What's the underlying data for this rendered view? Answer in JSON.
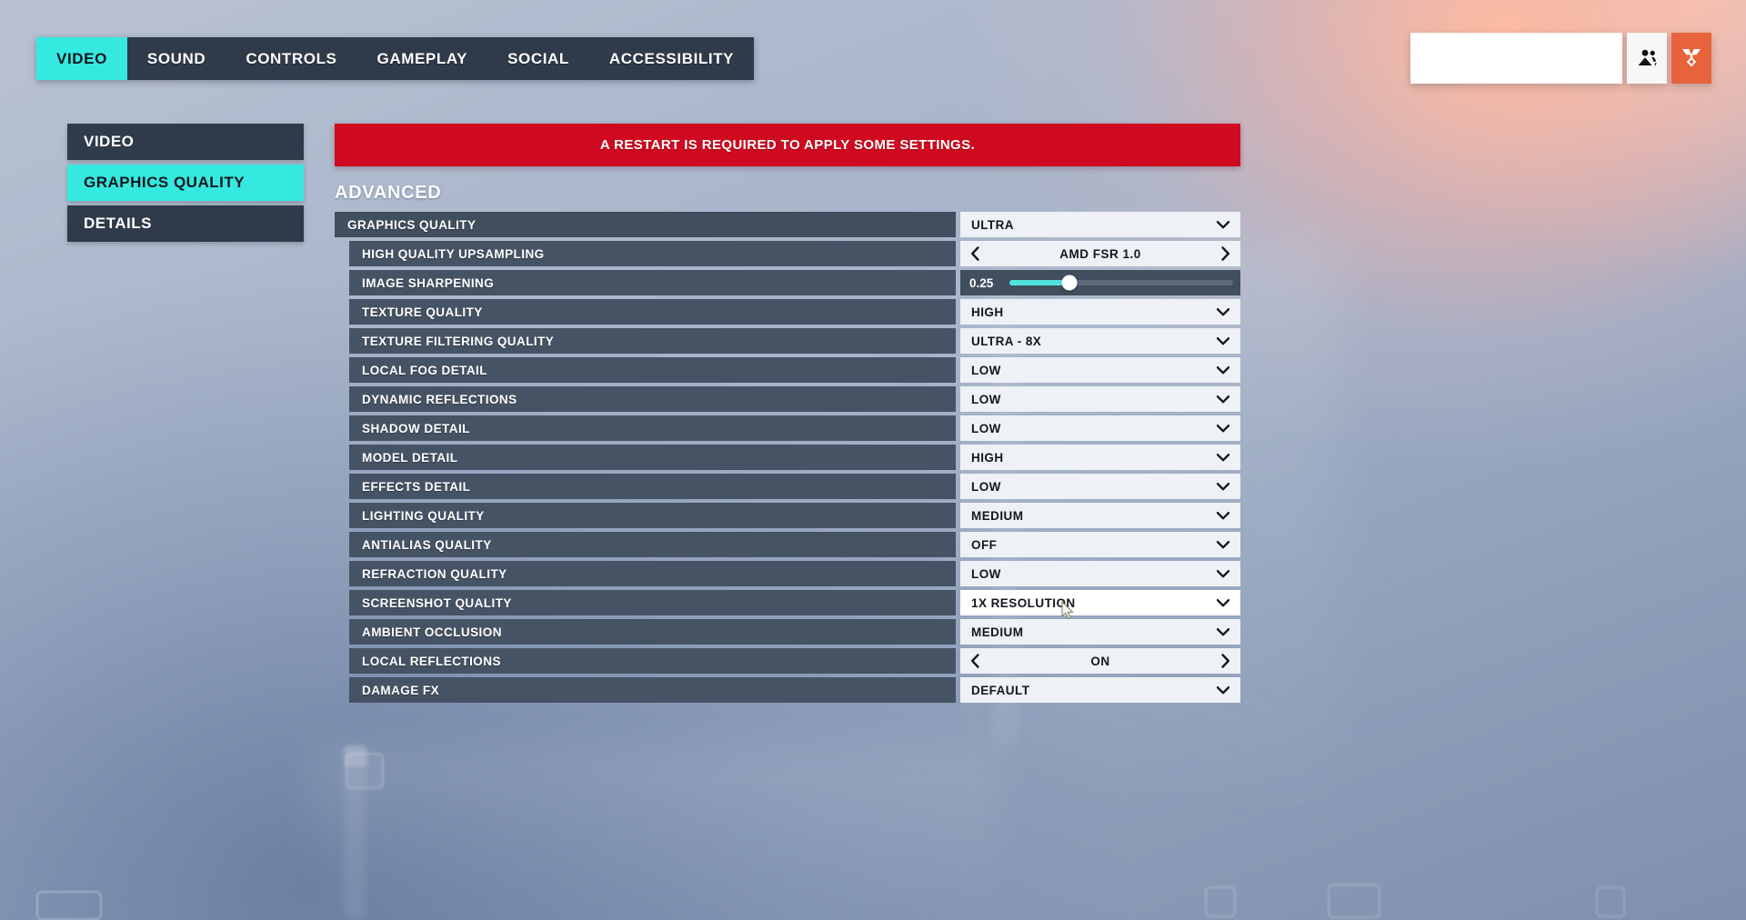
{
  "tabs": [
    {
      "label": "VIDEO",
      "active": true
    },
    {
      "label": "SOUND",
      "active": false
    },
    {
      "label": "CONTROLS",
      "active": false
    },
    {
      "label": "GAMEPLAY",
      "active": false
    },
    {
      "label": "SOCIAL",
      "active": false
    },
    {
      "label": "ACCESSIBILITY",
      "active": false
    }
  ],
  "hud": {
    "squad_icon": "squad-people-icon",
    "medal_icon": "medal-icon",
    "accent_color": "#e8633c"
  },
  "sidebar": {
    "items": [
      {
        "label": "VIDEO",
        "active": false
      },
      {
        "label": "GRAPHICS QUALITY",
        "active": true
      },
      {
        "label": "DETAILS",
        "active": false
      }
    ]
  },
  "banner": {
    "text": "A RESTART IS REQUIRED TO APPLY SOME SETTINGS.",
    "color": "#cf0a20"
  },
  "main": {
    "section_title": "ADVANCED",
    "accent_color": "#35e9e1",
    "settings": [
      {
        "label": "GRAPHICS QUALITY",
        "control": "dropdown",
        "value": "ULTRA",
        "indent": false,
        "hover": false
      },
      {
        "label": "HIGH QUALITY UPSAMPLING",
        "control": "stepper",
        "value": "AMD FSR 1.0",
        "indent": true,
        "hover": false
      },
      {
        "label": "IMAGE SHARPENING",
        "control": "slider",
        "value": "0.25",
        "indent": true,
        "hover": false,
        "percent": 27
      },
      {
        "label": "TEXTURE QUALITY",
        "control": "dropdown",
        "value": "HIGH",
        "indent": true,
        "hover": false
      },
      {
        "label": "TEXTURE FILTERING QUALITY",
        "control": "dropdown",
        "value": "ULTRA - 8X",
        "indent": true,
        "hover": false
      },
      {
        "label": "LOCAL FOG DETAIL",
        "control": "dropdown",
        "value": "LOW",
        "indent": true,
        "hover": false
      },
      {
        "label": "DYNAMIC REFLECTIONS",
        "control": "dropdown",
        "value": "LOW",
        "indent": true,
        "hover": false
      },
      {
        "label": "SHADOW DETAIL",
        "control": "dropdown",
        "value": "LOW",
        "indent": true,
        "hover": false
      },
      {
        "label": "MODEL DETAIL",
        "control": "dropdown",
        "value": "HIGH",
        "indent": true,
        "hover": false
      },
      {
        "label": "EFFECTS DETAIL",
        "control": "dropdown",
        "value": "LOW",
        "indent": true,
        "hover": false
      },
      {
        "label": "LIGHTING QUALITY",
        "control": "dropdown",
        "value": "MEDIUM",
        "indent": true,
        "hover": false
      },
      {
        "label": "ANTIALIAS QUALITY",
        "control": "dropdown",
        "value": "OFF",
        "indent": true,
        "hover": false
      },
      {
        "label": "REFRACTION QUALITY",
        "control": "dropdown",
        "value": "LOW",
        "indent": true,
        "hover": false
      },
      {
        "label": "SCREENSHOT QUALITY",
        "control": "dropdown",
        "value": "1X RESOLUTION",
        "indent": true,
        "hover": true
      },
      {
        "label": "AMBIENT OCCLUSION",
        "control": "dropdown",
        "value": "MEDIUM",
        "indent": true,
        "hover": false
      },
      {
        "label": "LOCAL REFLECTIONS",
        "control": "stepper",
        "value": "ON",
        "indent": true,
        "hover": false
      },
      {
        "label": "DAMAGE FX",
        "control": "dropdown",
        "value": "DEFAULT",
        "indent": true,
        "hover": false
      }
    ]
  }
}
